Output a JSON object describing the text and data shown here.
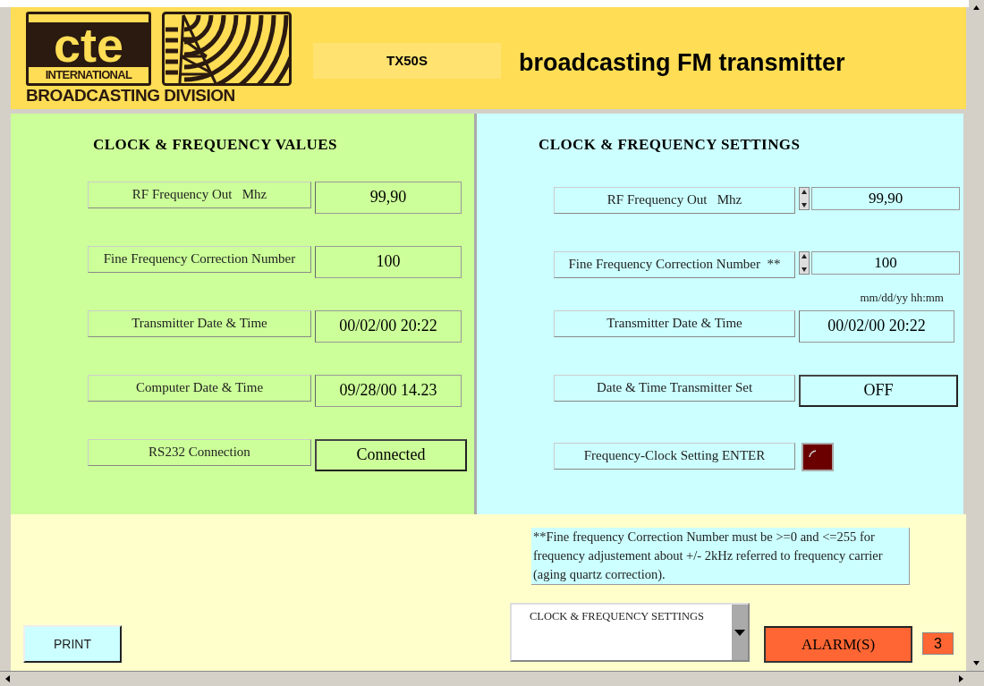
{
  "header": {
    "logo": {
      "brand": "cte",
      "sub": "INTERNATIONAL",
      "division": "BROADCASTING DIVISION"
    },
    "model": "TX50S",
    "title": "broadcasting FM transmitter"
  },
  "values_panel": {
    "title": "CLOCK & FREQUENCY VALUES",
    "rows": [
      {
        "label": "RF Frequency Out   Mhz",
        "kind": "field",
        "value": "99,90"
      },
      {
        "label": "Fine Frequency Correction Number",
        "kind": "field",
        "value": "100"
      },
      {
        "label": "Transmitter Date & Time",
        "kind": "field",
        "value": "00/02/00 20:22"
      },
      {
        "label": "Computer Date & Time",
        "kind": "field",
        "value": "09/28/00 14.23"
      },
      {
        "label": "RS232 Connection",
        "kind": "button",
        "value": "Connected"
      }
    ]
  },
  "settings_panel": {
    "title": "CLOCK & FREQUENCY SETTINGS",
    "rows": [
      {
        "label": "RF Frequency Out   Mhz",
        "kind": "spinner",
        "value": "99,90"
      },
      {
        "label": "Fine Frequency Correction Number  **",
        "kind": "spinner",
        "value": "100"
      },
      {
        "label": "Transmitter Date & Time",
        "kind": "field",
        "value": "00/02/00 20:22",
        "hint": "mm/dd/yy hh:mm"
      },
      {
        "label": "Date & Time Transmitter Set",
        "kind": "button",
        "value": "OFF"
      },
      {
        "label": "Frequency-Clock Setting ENTER",
        "kind": "led"
      }
    ]
  },
  "note": "**Fine frequency Correction Number must be >=0 and <=255 for frequency adjustement about +/- 2kHz referred to frequency carrier (aging quartz correction).",
  "print_button": "PRINT",
  "page_select": {
    "value": "CLOCK & FREQUENCY SETTINGS"
  },
  "alarm_button": "ALARM(S)",
  "alarm_count": "3"
}
